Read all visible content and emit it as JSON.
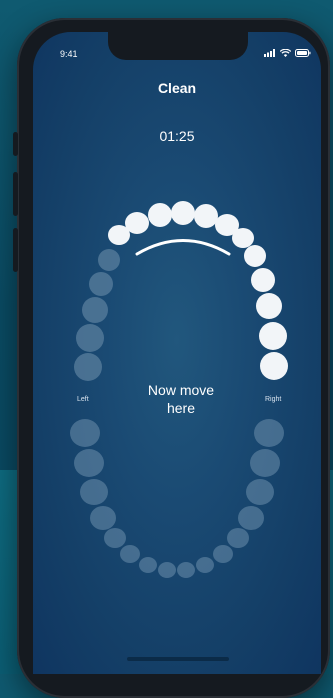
{
  "status_bar": {
    "time": "9:41",
    "icons": [
      "cellular-signal-icon",
      "wifi-icon",
      "battery-icon"
    ]
  },
  "screen": {
    "title": "Clean",
    "timer": "01:25",
    "instruction_line1": "Now move",
    "instruction_line2": "here",
    "left_label": "Left",
    "right_label": "Right"
  },
  "colors": {
    "background": "#0a4b63",
    "screen": "#1a4a73",
    "active_tooth": "#ffffff",
    "inactive_tooth": "#5a7f9e",
    "progress_arc": "#ffffff"
  },
  "teeth": {
    "upper_active_count": 12,
    "upper_inactive_count": 8,
    "lower_inactive_count": 18
  }
}
